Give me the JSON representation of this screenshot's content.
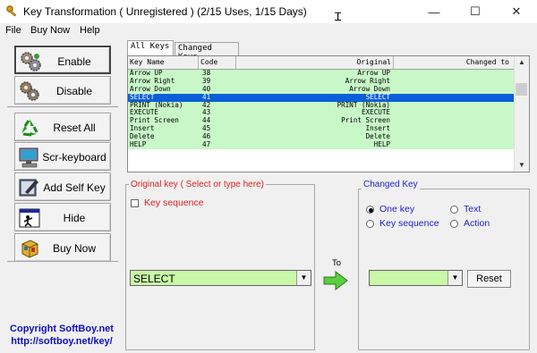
{
  "window": {
    "title": "Key Transformation ( Unregistered ) (2/15 Uses, 1/15 Days)",
    "controls": {
      "minimize": "—",
      "maximize": "☐",
      "close": "✕"
    }
  },
  "menu": [
    {
      "label": "File"
    },
    {
      "label": "Buy Now"
    },
    {
      "label": "Help"
    }
  ],
  "sidebar": {
    "buttons": [
      {
        "label": "Enable",
        "icon": "gears-icon"
      },
      {
        "label": "Disable",
        "icon": "gears-off-icon"
      },
      {
        "label": "Reset All",
        "icon": "recycle-icon"
      },
      {
        "label": "Scr-keyboard",
        "icon": "monitor-icon"
      },
      {
        "label": "Add Self Key",
        "icon": "edit-icon"
      },
      {
        "label": "Hide",
        "icon": "hide-window-icon"
      },
      {
        "label": "Buy Now",
        "icon": "buy-box-icon"
      }
    ],
    "copyright": "Copyright  SoftBoy.net",
    "url": "http://softboy.net/key/"
  },
  "tabs": [
    {
      "label": "All Keys",
      "active": true
    },
    {
      "label": "Changed Keys",
      "active": false
    }
  ],
  "table": {
    "columns": [
      "Key Name",
      "Code",
      "Original",
      "Changed to"
    ],
    "rows": [
      {
        "name": "Arrow UP",
        "code": "38",
        "original": "Arrow UP",
        "changed": "",
        "selected": false
      },
      {
        "name": "Arrow Right",
        "code": "39",
        "original": "Arrow Right",
        "changed": "",
        "selected": false
      },
      {
        "name": "Arrow Down",
        "code": "40",
        "original": "Arrow Down",
        "changed": "",
        "selected": false
      },
      {
        "name": "SELECT",
        "code": "41",
        "original": "SELECT",
        "changed": "",
        "selected": true
      },
      {
        "name": "PRINT (Nokia)",
        "code": "42",
        "original": "PRINT (Nokia)",
        "changed": "",
        "selected": false
      },
      {
        "name": "EXECUTE",
        "code": "43",
        "original": "EXECUTE",
        "changed": "",
        "selected": false
      },
      {
        "name": "Print Screen",
        "code": "44",
        "original": "Print Screen",
        "changed": "",
        "selected": false
      },
      {
        "name": "Insert",
        "code": "45",
        "original": "Insert",
        "changed": "",
        "selected": false
      },
      {
        "name": "Delete",
        "code": "46",
        "original": "Delete",
        "changed": "",
        "selected": false
      },
      {
        "name": "HELP",
        "code": "47",
        "original": "HELP",
        "changed": "",
        "selected": false
      }
    ]
  },
  "original_key": {
    "title": "Original key ( Select or type here)",
    "key_sequence_label": "Key sequence",
    "key_sequence_checked": false,
    "value": "SELECT"
  },
  "to_label": "To",
  "changed_key": {
    "title": "Changed Key",
    "options": [
      {
        "label": "One key",
        "checked": true
      },
      {
        "label": "Text",
        "checked": false
      },
      {
        "label": "Key sequence",
        "checked": false
      },
      {
        "label": "Action",
        "checked": false
      }
    ],
    "value": "",
    "reset_label": "Reset"
  },
  "colors": {
    "row_green": "#c8f8c8",
    "selected_row": "#0a5fd8",
    "combo_green": "#c8f8a8",
    "original_title": "#e02020",
    "changed_title": "#2020d0",
    "copyright": "#1010c0"
  }
}
